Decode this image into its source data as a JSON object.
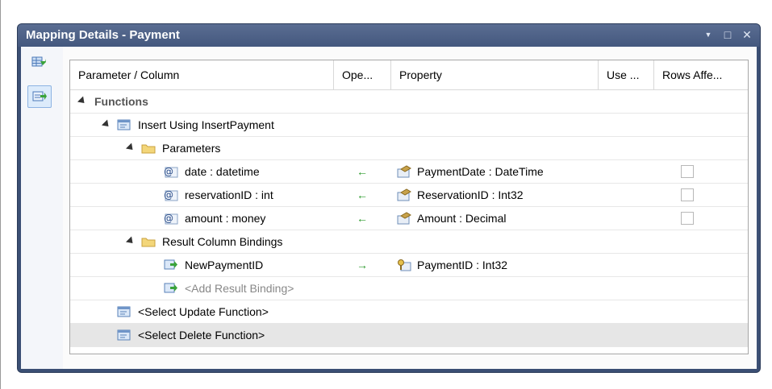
{
  "window": {
    "title": "Mapping Details - Payment",
    "controls": {
      "dropdown": "▼",
      "maximize": "□",
      "close": "✕"
    }
  },
  "columns": [
    "Parameter / Column",
    "Ope...",
    "Property",
    "Use ...",
    "Rows Affe..."
  ],
  "tree": {
    "functions_label": "Functions",
    "insert_label": "Insert Using InsertPayment",
    "parameters_label": "Parameters",
    "parameters": [
      {
        "name": "date : datetime",
        "op": "←",
        "property": "PaymentDate : DateTime",
        "rows_affected": false
      },
      {
        "name": "reservationID : int",
        "op": "←",
        "property": "ReservationID : Int32",
        "rows_affected": false
      },
      {
        "name": "amount : money",
        "op": "←",
        "property": "Amount : Decimal",
        "rows_affected": false
      }
    ],
    "result_label": "Result Column Bindings",
    "result_bindings": [
      {
        "name": "NewPaymentID",
        "op": "→",
        "property": "PaymentID : Int32"
      }
    ],
    "add_result": "<Add Result Binding>",
    "update_label": "<Select Update Function>",
    "delete_label": "<Select Delete Function>"
  },
  "colors": {
    "title_bar": "#44587e",
    "arrow": "#2a9a2a",
    "selected_row": "#e6e6e6"
  }
}
